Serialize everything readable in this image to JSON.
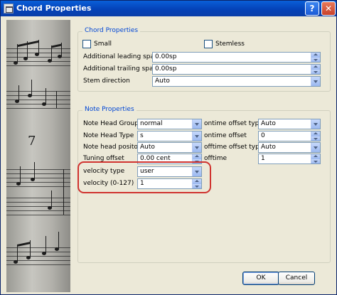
{
  "window": {
    "title": "Chord Properties",
    "help_label": "?",
    "close_label": "✕"
  },
  "chord_properties": {
    "legend": "Chord Properties",
    "small_label": "Small",
    "small_checked": false,
    "stemless_label": "Stemless",
    "stemless_checked": false,
    "leading_space_label": "Additional leading space",
    "leading_space_value": "0.00sp",
    "trailing_space_label": "Additional trailing space",
    "trailing_space_value": "0.00sp",
    "stem_direction_label": "Stem direction",
    "stem_direction_value": "Auto"
  },
  "note_properties": {
    "legend": "Note Properties",
    "note_head_group_label": "Note Head Group",
    "note_head_group_value": "normal",
    "note_head_type_label": "Note Head Type",
    "note_head_type_value": "s",
    "note_head_position_label": "Note head positon",
    "note_head_position_value": "Auto",
    "tuning_offset_label": "Tuning offset",
    "tuning_offset_value": "0.00 cent",
    "velocity_type_label": "velocity type",
    "velocity_type_value": "user",
    "velocity_label": "velocity (0-127)",
    "velocity_value": "1",
    "ontime_offset_type_label": "ontime offset type",
    "ontime_offset_type_value": "Auto",
    "ontime_offset_label": "ontime offset",
    "ontime_offset_value": "0",
    "offtime_offset_type_label": "offtime offset type",
    "offtime_offset_type_value": "Auto",
    "offtime_label": "offtime",
    "offtime_value": "1"
  },
  "buttons": {
    "ok_label": "OK",
    "cancel_label": "Cancel"
  },
  "colors": {
    "title_bar": "#0442b8",
    "legend_text": "#0046d5",
    "highlight": "#d0332f",
    "dialog_bg": "#ece9d8"
  }
}
